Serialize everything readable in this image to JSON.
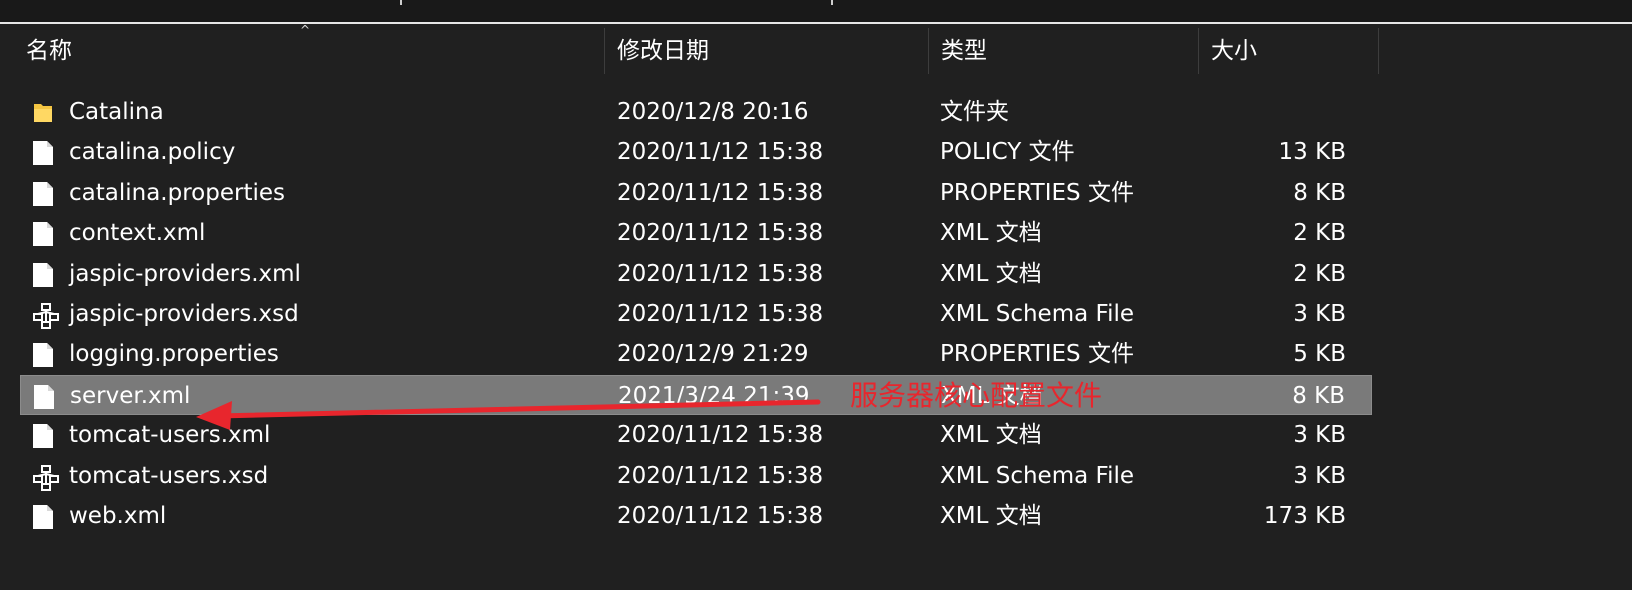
{
  "columns": {
    "name": "名称",
    "date": "修改日期",
    "type": "类型",
    "size": "大小"
  },
  "files": [
    {
      "icon": "folder-icon",
      "name": "Catalina",
      "date": "2020/12/8 20:16",
      "type": "文件夹",
      "size": ""
    },
    {
      "icon": "file-icon",
      "name": "catalina.policy",
      "date": "2020/11/12 15:38",
      "type": "POLICY 文件",
      "size": "13 KB"
    },
    {
      "icon": "file-icon",
      "name": "catalina.properties",
      "date": "2020/11/12 15:38",
      "type": "PROPERTIES 文件",
      "size": "8 KB"
    },
    {
      "icon": "file-icon",
      "name": "context.xml",
      "date": "2020/11/12 15:38",
      "type": "XML 文档",
      "size": "2 KB"
    },
    {
      "icon": "file-icon",
      "name": "jaspic-providers.xml",
      "date": "2020/11/12 15:38",
      "type": "XML 文档",
      "size": "2 KB"
    },
    {
      "icon": "schema-file-icon",
      "name": "jaspic-providers.xsd",
      "date": "2020/11/12 15:38",
      "type": "XML Schema File",
      "size": "3 KB"
    },
    {
      "icon": "file-icon",
      "name": "logging.properties",
      "date": "2020/12/9 21:29",
      "type": "PROPERTIES 文件",
      "size": "5 KB"
    },
    {
      "icon": "file-icon",
      "name": "server.xml",
      "date": "2021/3/24 21:39",
      "type": "XML 文档",
      "size": "8 KB",
      "selected": true
    },
    {
      "icon": "file-icon",
      "name": "tomcat-users.xml",
      "date": "2020/11/12 15:38",
      "type": "XML 文档",
      "size": "3 KB"
    },
    {
      "icon": "schema-file-icon",
      "name": "tomcat-users.xsd",
      "date": "2020/11/12 15:38",
      "type": "XML Schema File",
      "size": "3 KB"
    },
    {
      "icon": "file-icon",
      "name": "web.xml",
      "date": "2020/11/12 15:38",
      "type": "XML 文档",
      "size": "173 KB"
    }
  ],
  "annotation": {
    "text": "服务器核心配置文件",
    "color": "#e8262d"
  },
  "colors": {
    "background": "#202020",
    "selected_row": "#7a7a7a",
    "folder": "#f4c542"
  }
}
